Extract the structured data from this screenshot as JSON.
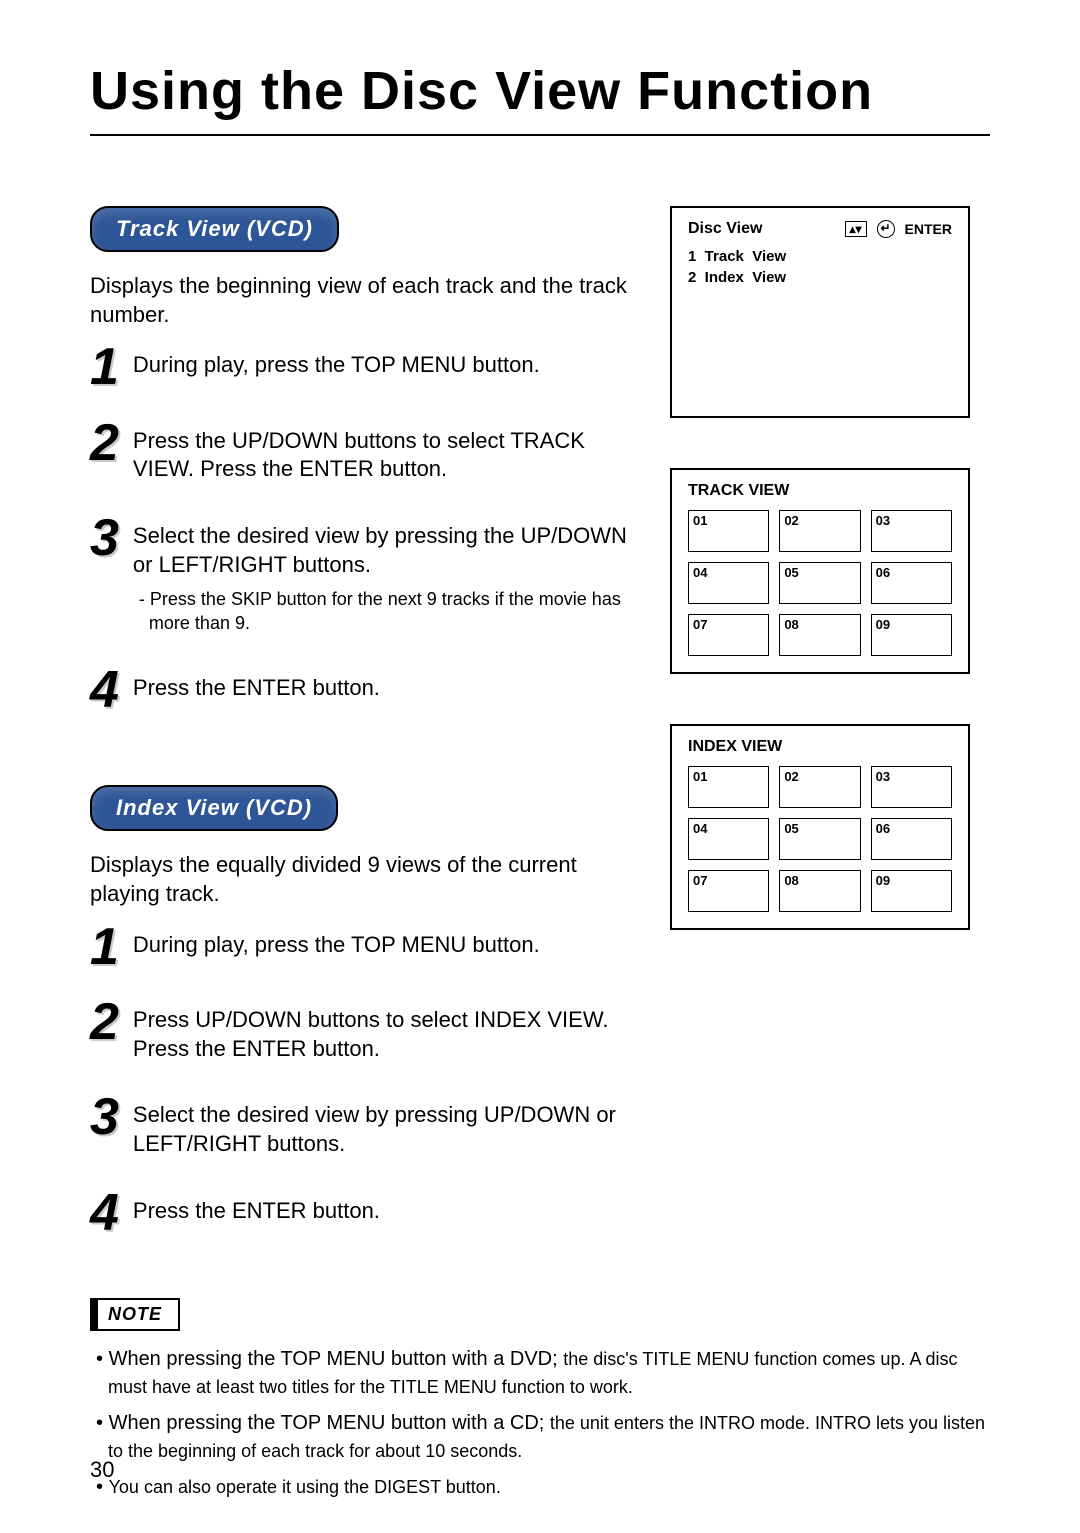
{
  "title": "Using the Disc View Function",
  "page_number": "30",
  "track_view": {
    "label": "Track View (VCD)",
    "intro": "Displays the beginning view of each track and the track number.",
    "steps": [
      {
        "num": "1",
        "text": "During play, press the TOP MENU button."
      },
      {
        "num": "2",
        "text": "Press the UP/DOWN buttons to select TRACK VIEW. Press the ENTER button."
      },
      {
        "num": "3",
        "text": "Select the desired view by pressing the UP/DOWN or LEFT/RIGHT buttons.",
        "sub": "- Press the SKIP button for the next 9 tracks if the movie has more than 9."
      },
      {
        "num": "4",
        "text": "Press the ENTER button."
      }
    ]
  },
  "index_view": {
    "label": "Index View (VCD)",
    "intro": "Displays the equally divided 9 views of the current playing track.",
    "steps": [
      {
        "num": "1",
        "text": "During play, press the TOP MENU button."
      },
      {
        "num": "2",
        "text": "Press UP/DOWN buttons to select INDEX VIEW. Press the ENTER button."
      },
      {
        "num": "3",
        "text": "Select the desired view by pressing UP/DOWN or LEFT/RIGHT buttons."
      },
      {
        "num": "4",
        "text": "Press the ENTER button."
      }
    ]
  },
  "disc_view_panel": {
    "title": "Disc View",
    "enter_label": "ENTER",
    "updown_glyph": "▴▾",
    "enter_glyph": "↵",
    "menu": [
      "1  Track  View",
      "2  Index  View"
    ]
  },
  "track_grid": {
    "title": "TRACK VIEW",
    "cells": [
      "01",
      "02",
      "03",
      "04",
      "05",
      "06",
      "07",
      "08",
      "09"
    ]
  },
  "index_grid": {
    "title": "INDEX VIEW",
    "cells": [
      "01",
      "02",
      "03",
      "04",
      "05",
      "06",
      "07",
      "08",
      "09"
    ]
  },
  "note": {
    "label": "NOTE",
    "items": [
      {
        "lead": "When pressing the TOP MENU button with a DVD; ",
        "tail": "the disc's TITLE MENU function comes up. A disc must have at least two titles for the TITLE MENU function to work."
      },
      {
        "lead": "When pressing the TOP MENU button with a CD; ",
        "tail": "the unit enters the INTRO mode. INTRO lets you listen to the beginning of each track for about 10 seconds."
      },
      {
        "lead": "",
        "tail": "You can also operate it using the DIGEST button."
      }
    ]
  }
}
